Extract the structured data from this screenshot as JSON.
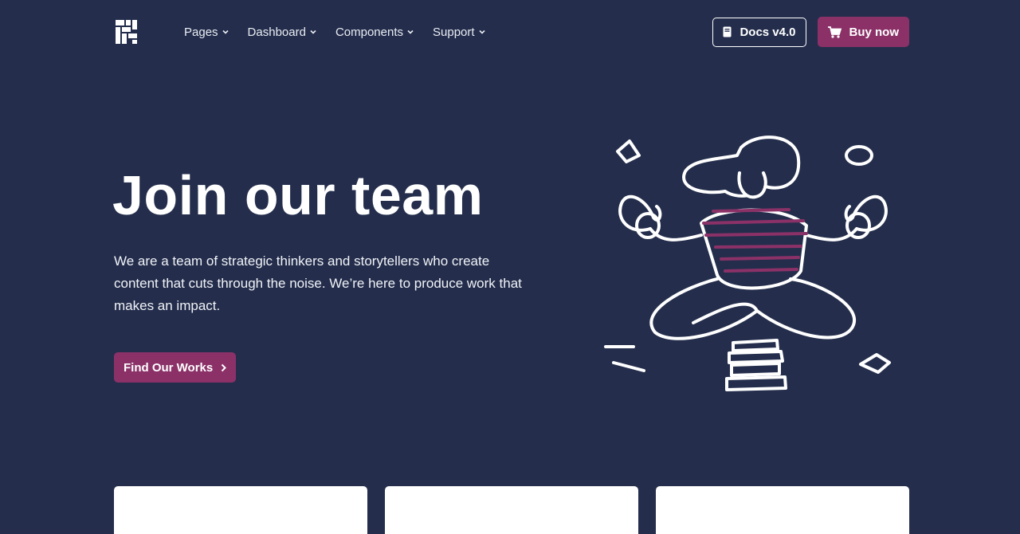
{
  "nav": {
    "items": [
      {
        "label": "Pages"
      },
      {
        "label": "Dashboard"
      },
      {
        "label": "Components"
      },
      {
        "label": "Support"
      }
    ],
    "docs_label": "Docs v4.0",
    "buy_label": "Buy now"
  },
  "hero": {
    "title": "Join our team",
    "text": "We are a team of strategic thinkers and storytellers who create content that cuts through the noise. We’re here to produce work that makes an impact.",
    "cta_label": "Find Our Works"
  },
  "colors": {
    "background": "#242e4c",
    "accent": "#8b3168"
  },
  "icons": [
    "logo-icon",
    "chevron-down-icon",
    "book-icon",
    "cart-icon",
    "chevron-right-icon"
  ]
}
